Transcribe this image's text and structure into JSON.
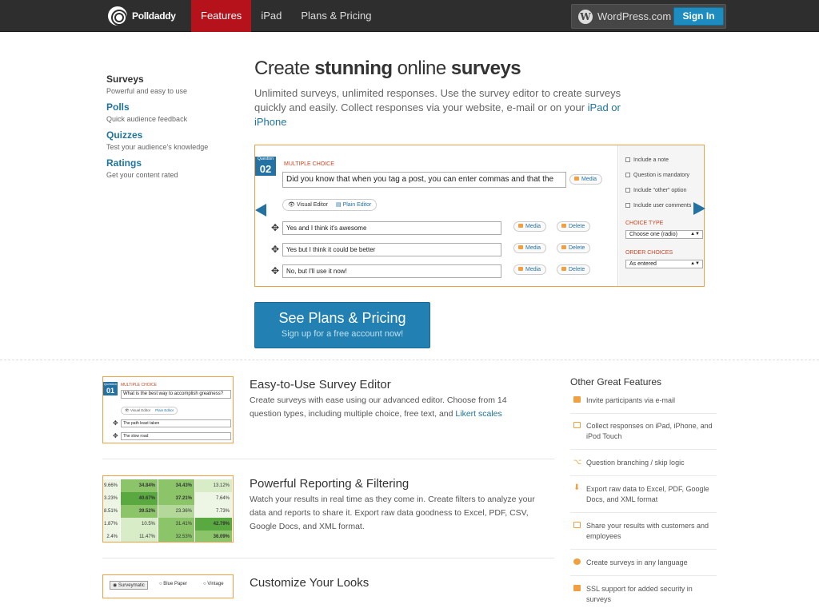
{
  "header": {
    "logo_text": "Polldaddy",
    "nav": [
      {
        "label": "Features",
        "active": true
      },
      {
        "label": "iPad",
        "active": false
      },
      {
        "label": "Plans & Pricing",
        "active": false
      }
    ],
    "wordpress_label": "WordPress.com",
    "sign_in": "Sign In"
  },
  "sidebar": {
    "items": [
      {
        "title": "Surveys",
        "desc": "Powerful and easy to use",
        "current": true
      },
      {
        "title": "Polls",
        "desc": "Quick audience feedback",
        "current": false
      },
      {
        "title": "Quizzes",
        "desc": "Test your audience's knowledge",
        "current": false
      },
      {
        "title": "Ratings",
        "desc": "Get your content rated",
        "current": false
      }
    ]
  },
  "hero": {
    "title_pre": "Create ",
    "title_b1": "stunning",
    "title_mid": " online ",
    "title_b2": "surveys",
    "desc_text": "Unlimited surveys, unlimited responses. Use the survey editor to create surveys quickly and easily. Collect responses via your website, e-mail or on your ",
    "desc_link": "iPad or iPhone"
  },
  "editor": {
    "question_small": "Question",
    "question_num": "02",
    "type_label": "MULTIPLE CHOICE",
    "question_text": "Did you know that when you tag a post, you can enter commas and that the",
    "media": "Media",
    "delete": "Delete",
    "visual_editor": "Visual Editor",
    "plain_editor": "Plain Editor",
    "answers": [
      "Yes and I think it's awesome",
      "Yes but I think it could be better",
      "No, but I'll use it now!"
    ],
    "options": [
      "Include a note",
      "Question is mandatory",
      "Include \"other\" option",
      "Include user comments"
    ],
    "choice_type_label": "CHOICE TYPE",
    "choice_type_value": "Choose one (radio)",
    "order_label": "ORDER CHOICES",
    "order_value": "As entered"
  },
  "cta": {
    "title": "See Plans & Pricing",
    "sub": "Sign up for a free account now!"
  },
  "features": [
    {
      "title": "Easy-to-Use Survey Editor",
      "text": "Create surveys with ease using our advanced editor. Choose from 14 question types, including multiple choice, free text, and ",
      "link": "Likert scales"
    },
    {
      "title": "Powerful Reporting & Filtering",
      "text": "Watch your results in real time as they come in. Create filters to analyze your data and reports to share it. Export raw data goodness to Excel, PDF, CSV, Google Docs, and XML format.",
      "link": ""
    },
    {
      "title": "Customize Your Looks",
      "text": "",
      "link": ""
    }
  ],
  "thumb1": {
    "small": "Question",
    "num": "01",
    "type": "MULTIPLE CHOICE",
    "question": "What is the best way to accomplish greatness?",
    "visual": "Visual Editor",
    "plain": "Plain Editor",
    "answers": [
      "The path least taken",
      "The slow road"
    ]
  },
  "thumb2": {
    "rows": [
      [
        "9.66%",
        "34.84%",
        "34.43%",
        "13.12%"
      ],
      [
        "3.23%",
        "40.67%",
        "37.21%",
        "7.64%"
      ],
      [
        "8.51%",
        "39.52%",
        "23.36%",
        "7.73%"
      ],
      [
        "1.87%",
        "10.5%",
        "31.41%",
        "42.79%"
      ],
      [
        "2.4%",
        "11.47%",
        "32.53%",
        "36.09%"
      ]
    ]
  },
  "thumb3": {
    "options": [
      "Surveymatic",
      "Blue Paper",
      "Vintage"
    ]
  },
  "other": {
    "title": "Other Great Features",
    "items": [
      "Invite participants via e-mail",
      "Collect responses on iPad, iPhone, and iPod Touch",
      "Question branching / skip logic",
      "Export raw data to Excel, PDF, Google Docs, and XML format",
      "Share your results with customers and employees",
      "Create surveys in any language",
      "SSL support for added security in surveys"
    ]
  },
  "colors": {
    "accent": "#b5121b",
    "link": "#21759b",
    "button": "#2281b2",
    "highlight": "#f0a040"
  }
}
